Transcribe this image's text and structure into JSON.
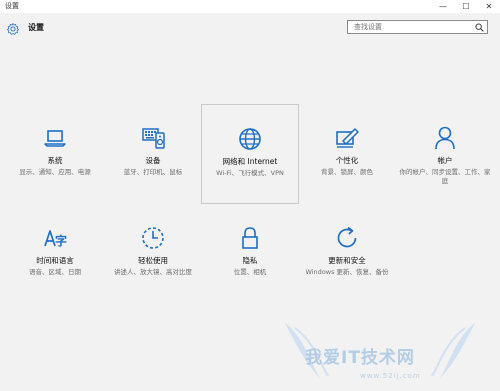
{
  "window": {
    "title": "设置",
    "min": "—",
    "max": "☐",
    "close": "✕"
  },
  "header": {
    "title": "设置"
  },
  "search": {
    "placeholder": "查找设置"
  },
  "tiles": [
    {
      "name": "系统",
      "desc": "显示、通知、应用、电源",
      "icon": "laptop-icon"
    },
    {
      "name": "设备",
      "desc": "蓝牙、打印机、鼠标",
      "icon": "devices-icon"
    },
    {
      "name": "网络和 Internet",
      "desc": "Wi-Fi、飞行模式、VPN",
      "icon": "globe-icon"
    },
    {
      "name": "个性化",
      "desc": "背景、锁屏、颜色",
      "icon": "personalization-icon"
    },
    {
      "name": "帐户",
      "desc": "你的帐户、同步设置、工作、家庭",
      "icon": "person-icon"
    },
    {
      "name": "时间和语言",
      "desc": "语音、区域、日期",
      "icon": "time-language-icon"
    },
    {
      "name": "轻松使用",
      "desc": "讲述人、放大镜、高对比度",
      "icon": "ease-of-access-icon"
    },
    {
      "name": "隐私",
      "desc": "位置、相机",
      "icon": "lock-icon"
    },
    {
      "name": "更新和安全",
      "desc": "Windows 更新、恢复、备份",
      "icon": "update-icon"
    }
  ],
  "watermark": {
    "text": "我爱IT技术网",
    "url": "www.52ij.com"
  },
  "colors": {
    "accent": "#1e6fc4",
    "background": "#f2f2f2"
  }
}
